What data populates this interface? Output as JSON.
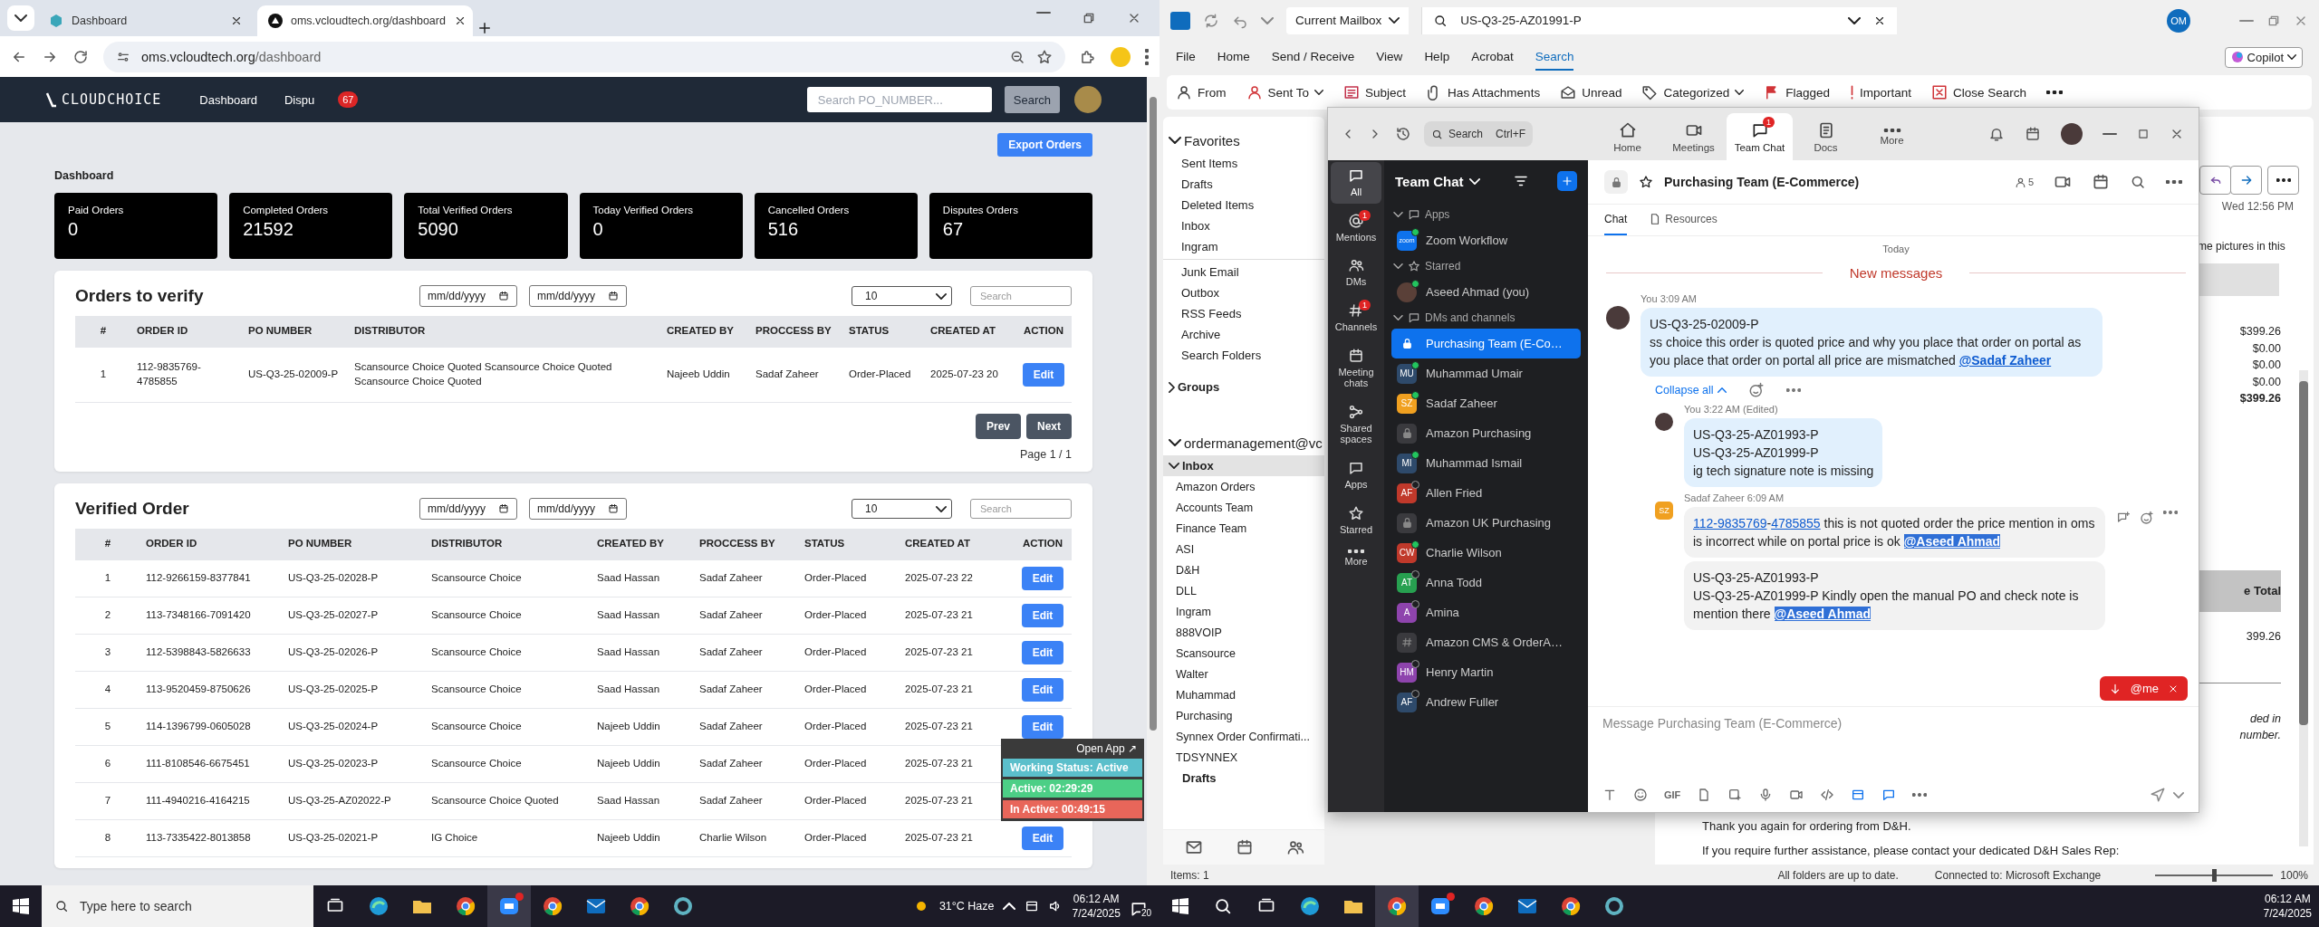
{
  "browser": {
    "tabs": [
      {
        "title": "Dashboard",
        "selected": false
      },
      {
        "title": "oms.vcloudtech.org/dashboard",
        "selected": true
      }
    ],
    "url_host": "oms.vcloudtech.org",
    "url_path": "/dashboard",
    "page": {
      "brand": "CLOUDCHOICE",
      "nav": [
        {
          "label": "Dashboard"
        },
        {
          "label": "Dispu",
          "badge": "67"
        }
      ],
      "search": {
        "placeholder": "Search PO_NUMBER...",
        "button": "Search"
      },
      "export_button": "Export Orders",
      "heading": "Dashboard",
      "stats": [
        {
          "label": "Paid Orders",
          "value": "0"
        },
        {
          "label": "Completed Orders",
          "value": "21592"
        },
        {
          "label": "Total Verified Orders",
          "value": "5090"
        },
        {
          "label": "Today Verified Orders",
          "value": "0"
        },
        {
          "label": "Cancelled Orders",
          "value": "516"
        },
        {
          "label": "Disputes Orders",
          "value": "67"
        }
      ],
      "tables": [
        {
          "title": "Orders to verify",
          "date_placeholders": [
            "mm/dd/yyyy",
            "mm/dd/yyyy"
          ],
          "page_size": "10",
          "search_placeholder": "Search",
          "columns": [
            "#",
            "ORDER ID",
            "PO NUMBER",
            "DISTRIBUTOR",
            "CREATED BY",
            "PROCCESS BY",
            "STATUS",
            "CREATED AT",
            "ACTION"
          ],
          "rows": [
            {
              "cells": [
                "1",
                "112-9835769-4785855",
                "US-Q3-25-02009-P",
                "Scansource Choice Quoted Scansource Choice Quoted Scansource Choice Quoted",
                "Najeeb Uddin",
                "Sadaf Zaheer",
                "Order-Placed",
                "2025-07-23 20"
              ],
              "action": "Edit"
            }
          ],
          "pager": {
            "prev": "Prev",
            "next": "Next",
            "info": "Page 1 / 1"
          }
        },
        {
          "title": "Verified Order",
          "date_placeholders": [
            "mm/dd/yyyy",
            "mm/dd/yyyy"
          ],
          "page_size": "10",
          "search_placeholder": "Search",
          "columns": [
            "#",
            "ORDER ID",
            "PO NUMBER",
            "DISTRIBUTOR",
            "CREATED BY",
            "PROCCESS BY",
            "STATUS",
            "CREATED AT",
            "ACTION"
          ],
          "rows": [
            {
              "cells": [
                "1",
                "112-9266159-8377841",
                "US-Q3-25-02028-P",
                "Scansource Choice",
                "Saad Hassan",
                "Sadaf Zaheer",
                "Order-Placed",
                "2025-07-23 22"
              ],
              "action": "Edit"
            },
            {
              "cells": [
                "2",
                "113-7348166-7091420",
                "US-Q3-25-02027-P",
                "Scansource Choice",
                "Saad Hassan",
                "Sadaf Zaheer",
                "Order-Placed",
                "2025-07-23 21"
              ],
              "action": "Edit"
            },
            {
              "cells": [
                "3",
                "112-5398843-5826633",
                "US-Q3-25-02026-P",
                "Scansource Choice",
                "Saad Hassan",
                "Sadaf Zaheer",
                "Order-Placed",
                "2025-07-23 21"
              ],
              "action": "Edit"
            },
            {
              "cells": [
                "4",
                "113-9520459-8750626",
                "US-Q3-25-02025-P",
                "Scansource Choice",
                "Saad Hassan",
                "Sadaf Zaheer",
                "Order-Placed",
                "2025-07-23 21"
              ],
              "action": "Edit"
            },
            {
              "cells": [
                "5",
                "114-1396799-0605028",
                "US-Q3-25-02024-P",
                "Scansource Choice",
                "Najeeb Uddin",
                "Sadaf Zaheer",
                "Order-Placed",
                "2025-07-23 21"
              ],
              "action": "Edit"
            },
            {
              "cells": [
                "6",
                "111-8108546-6675451",
                "US-Q3-25-02023-P",
                "Scansource Choice",
                "Najeeb Uddin",
                "Sadaf Zaheer",
                "Order-Placed",
                "2025-07-23 21"
              ]
            },
            {
              "cells": [
                "7",
                "111-4940216-4164215",
                "US-Q3-25-AZ02022-P",
                "Scansource Choice Quoted",
                "Saad Hassan",
                "Sadaf Zaheer",
                "Order-Placed",
                "2025-07-23 21"
              ]
            },
            {
              "cells": [
                "8",
                "113-7335422-8013858",
                "US-Q3-25-02021-P",
                "IG Choice",
                "Najeeb Uddin",
                "Charlie Wilson",
                "Order-Placed",
                "2025-07-23 21"
              ],
              "action": "Edit"
            }
          ]
        }
      ]
    },
    "status_widget": {
      "open_app": "Open App ↗",
      "items": [
        {
          "kind": "status",
          "text": "Working Status: Active"
        },
        {
          "kind": "active",
          "text": "Active: 02:29:29"
        },
        {
          "kind": "inactive",
          "text": "In Active: 00:49:15"
        }
      ]
    }
  },
  "outlook": {
    "search_scope": "Current Mailbox",
    "search_query": "US-Q3-25-AZ01991-P",
    "account_initials": "OM",
    "copilot": "Copilot",
    "menu": [
      {
        "label": "File",
        "selected": false
      },
      {
        "label": "Home",
        "selected": false
      },
      {
        "label": "Send / Receive",
        "selected": false
      },
      {
        "label": "View",
        "selected": false
      },
      {
        "label": "Help",
        "selected": false
      },
      {
        "label": "Acrobat",
        "selected": false
      },
      {
        "label": "Search",
        "selected": true
      }
    ],
    "ribbon": [
      {
        "label": "From",
        "dropdown": false
      },
      {
        "label": "Sent To",
        "dropdown": true
      },
      {
        "label": "Subject",
        "dropdown": false
      },
      {
        "label": "Has Attachments",
        "dropdown": false
      },
      {
        "label": "Unread",
        "dropdown": false
      },
      {
        "label": "Categorized",
        "dropdown": true
      },
      {
        "label": "Flagged",
        "dropdown": false
      },
      {
        "label": "Important",
        "dropdown": false
      },
      {
        "label": "Close Search",
        "dropdown": false
      }
    ],
    "favorites": {
      "label": "Favorites",
      "expanded": true,
      "items": [
        {
          "label": "Sent Items",
          "selected": false
        },
        {
          "label": "Drafts",
          "selected": false
        },
        {
          "label": "Deleted Items",
          "selected": false
        },
        {
          "label": "Inbox",
          "selected": false
        },
        {
          "label": "Ingram",
          "selected": false
        }
      ]
    },
    "more_folders": [
      {
        "label": "Junk Email",
        "selected": false
      },
      {
        "label": "Outbox",
        "selected": false
      },
      {
        "label": "RSS Feeds",
        "selected": false
      },
      {
        "label": "Archive",
        "selected": false
      },
      {
        "label": "Search Folders",
        "selected": false
      }
    ],
    "groups": {
      "label": "Groups",
      "expanded": false
    },
    "mailbox": {
      "label": "ordermanagement@vc",
      "expanded": true,
      "folders": [
        {
          "label": "Inbox",
          "selected": true,
          "expanded": true,
          "children": [
            {
              "label": "Amazon Orders",
              "selected": false
            },
            {
              "label": "Accounts Team",
              "selected": false
            },
            {
              "label": "Finance Team",
              "selected": false
            },
            {
              "label": "ASI",
              "selected": false
            },
            {
              "label": "D&H",
              "selected": false
            },
            {
              "label": "DLL",
              "selected": false
            },
            {
              "label": "Ingram",
              "selected": false
            },
            {
              "label": "888VOIP",
              "selected": false
            },
            {
              "label": "Scansource",
              "selected": false
            },
            {
              "label": "Walter",
              "selected": false
            },
            {
              "label": "Muhammad",
              "selected": false
            },
            {
              "label": "Purchasing",
              "selected": false
            },
            {
              "label": "Synnex Order Confirmati...",
              "selected": false
            },
            {
              "label": "TDSYNNEX",
              "selected": false
            }
          ]
        },
        {
          "label": "Drafts",
          "selected": false,
          "expanded": false
        }
      ]
    },
    "reading_pane": {
      "date": "Wed 12:56 PM",
      "notice": "me pictures in this",
      "amounts": [
        {
          "kind": "line",
          "text": "$399.26"
        },
        {
          "kind": "line",
          "text": "$0.00"
        },
        {
          "kind": "line",
          "text": "$0.00"
        },
        {
          "kind": "line",
          "text": "$0.00"
        },
        {
          "kind": "total",
          "text": "$399.26"
        }
      ],
      "table_header": "e Total",
      "table_value": "399.26",
      "note_lines": [
        "ded in",
        "number."
      ],
      "closing": [
        "Thank you again for ordering from D&H.",
        "If you require further assistance, please contact your dedicated D&H Sales Rep:"
      ]
    },
    "status_bar": {
      "items": "Items: 1",
      "sync": "All folders are up to date.",
      "connection": "Connected to: Microsoft Exchange",
      "zoom_slider": {
        "level": 0.5
      },
      "zoom": "100%"
    }
  },
  "zoom": {
    "search": {
      "placeholder": "Search",
      "shortcut": "Ctrl+F"
    },
    "top_tabs": [
      {
        "label": "Home",
        "selected": false
      },
      {
        "label": "Meetings",
        "selected": false
      },
      {
        "label": "Team Chat",
        "selected": true,
        "badge": "1"
      },
      {
        "label": "Docs",
        "selected": false
      },
      {
        "label": "More",
        "selected": false
      }
    ],
    "rail": [
      {
        "label": "All",
        "selected": true
      },
      {
        "label": "Mentions",
        "selected": false,
        "badge": "1"
      },
      {
        "label": "DMs",
        "selected": false
      },
      {
        "label": "Channels",
        "selected": false,
        "badge": "1"
      },
      {
        "label": "Meeting chats",
        "selected": false
      },
      {
        "label": "Shared spaces",
        "selected": false
      },
      {
        "label": "Apps",
        "selected": false
      },
      {
        "label": "Starred",
        "selected": false
      },
      {
        "label": "More",
        "selected": false
      }
    ],
    "sidebar_title": "Team Chat",
    "sections": [
      {
        "title": "Apps",
        "expanded": true,
        "items": [
          {
            "name": "Zoom Workflow",
            "kind": "app",
            "badge": "zoom",
            "online": true,
            "selected": false
          }
        ]
      },
      {
        "title": "Starred",
        "expanded": true,
        "items": [
          {
            "name": "Aseed Ahmad (you)",
            "kind": "photo",
            "online": true,
            "selected": false
          }
        ]
      },
      {
        "title": "DMs and channels",
        "expanded": true,
        "items": [
          {
            "name": "Purchasing Team (E-Co…",
            "kind": "locked",
            "online": false,
            "selected": true
          },
          {
            "name": "Muhammad Umair",
            "kind": "initials",
            "initials": "MU",
            "color": "#2e4a6b",
            "online": true,
            "selected": false
          },
          {
            "name": "Sadaf Zaheer",
            "kind": "initials",
            "initials": "SZ",
            "color": "#f0a020",
            "online": true,
            "selected": false
          },
          {
            "name": "Amazon Purchasing",
            "kind": "locked",
            "online": false,
            "selected": false
          },
          {
            "name": "Muhammad Ismail",
            "kind": "initials",
            "initials": "MI",
            "color": "#2e4a6b",
            "online": true,
            "selected": false
          },
          {
            "name": "Allen Fried",
            "kind": "initials",
            "initials": "AF",
            "color": "#c0392b",
            "online": false,
            "selected": false
          },
          {
            "name": "Amazon UK Purchasing",
            "kind": "locked",
            "online": false,
            "selected": false
          },
          {
            "name": "Charlie Wilson",
            "kind": "initials",
            "initials": "CW",
            "color": "#c0392b",
            "online": true,
            "selected": false
          },
          {
            "name": "Anna Todd",
            "kind": "initials",
            "initials": "AT",
            "color": "#27a050",
            "online": false,
            "selected": false
          },
          {
            "name": "Amina",
            "kind": "initials",
            "initials": "A",
            "color": "#8e44ad",
            "online": false,
            "selected": false
          },
          {
            "name": "Amazon CMS & OrderA…",
            "kind": "hash",
            "online": false,
            "selected": false
          },
          {
            "name": "Henry Martin",
            "kind": "initials",
            "initials": "HM",
            "color": "#8e44ad",
            "online": false,
            "selected": false
          },
          {
            "name": "Andrew Fuller",
            "kind": "initials",
            "initials": "AF",
            "color": "#2e4a6b",
            "online": false,
            "selected": false
          }
        ]
      }
    ],
    "channel": {
      "title": "Purchasing Team (E-Commerce)",
      "members": "5",
      "tabs": [
        {
          "label": "Chat",
          "selected": true
        },
        {
          "label": "Resources",
          "selected": false
        }
      ]
    },
    "day": "Today",
    "new_messages": "New messages",
    "message": {
      "author": "You",
      "time": "3:09 AM",
      "segments": [
        {
          "kind": "text",
          "text": "US-Q3-25-02009-P\nss choice this order is quoted price and why you place that order on portal as you place that order on portal all price are mismatched "
        },
        {
          "kind": "mention",
          "text": "@Sadaf Zaheer",
          "highlighted": false
        }
      ]
    },
    "collapse": "Collapse all",
    "replies": [
      {
        "author": "You",
        "time": "3:22 AM (Edited)",
        "kind": "photo",
        "bubbles": [
          [
            {
              "kind": "text",
              "text": "US-Q3-25-AZ01993-P\nUS-Q3-25-AZ01999-P\nig tech signature note is missing"
            }
          ]
        ]
      },
      {
        "author": "Sadaf Zaheer",
        "time": "6:09 AM",
        "kind": "initials",
        "initials": "SZ",
        "bubbles": [
          [
            {
              "kind": "link",
              "text": "112-9835769"
            },
            {
              "kind": "text",
              "text": "-"
            },
            {
              "kind": "link",
              "text": "4785855"
            },
            {
              "kind": "text",
              "text": " this is not quoted order the price mention in oms is incorrect while on portal price is ok "
            },
            {
              "kind": "mention",
              "text": "@Aseed Ahmad",
              "highlighted": true
            }
          ],
          [
            {
              "kind": "text",
              "text": "US-Q3-25-AZ01993-P\nUS-Q3-25-AZ01999-P Kindly open the manual PO and check note is mention there "
            },
            {
              "kind": "mention",
              "text": "@Aseed Ahmad",
              "highlighted": true
            }
          ]
        ]
      }
    ],
    "jump": "@me",
    "composer_placeholder": "Message Purchasing Team (E-Commerce)",
    "gif": "GIF"
  },
  "taskbars": [
    {
      "search_placeholder": "Type here to search",
      "weather": "31°C Haze",
      "time": "06:12 AM",
      "date": "7/24/2025",
      "notifications": "20"
    },
    {
      "time": "06:12 AM",
      "date": "7/24/2025"
    }
  ]
}
